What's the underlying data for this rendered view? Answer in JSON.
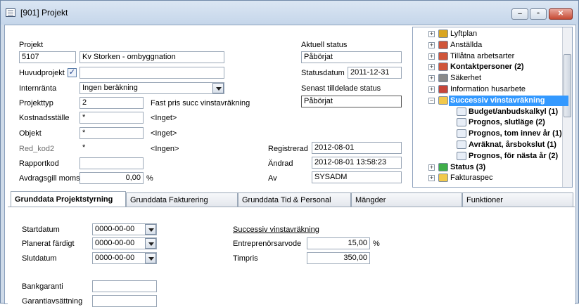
{
  "window": {
    "title": "[901]  Projekt",
    "minimize": "–",
    "maximize": "▫",
    "close": "✕"
  },
  "form": {
    "projekt_label": "Projekt",
    "projekt_id": "5107",
    "projekt_name": "Kv Storken - ombyggnation",
    "huvudprojekt_label": "Huvudprojekt",
    "huvudprojekt_checked": "✓",
    "huvudprojekt_value": "",
    "internranta_label": "Internränta",
    "internranta_value": "Ingen beräkning",
    "projekttyp_label": "Projekttyp",
    "projekttyp_value": "2",
    "projekttyp_desc": "Fast pris succ vinstavräkning",
    "kostnadsstalle_label": "Kostnadsställe",
    "kostnadsstalle_value": "*",
    "kostnadsstalle_desc": "<Inget>",
    "objekt_label": "Objekt",
    "objekt_value": "*",
    "objekt_desc": "<Inget>",
    "red_kod2_label": "Red_kod2",
    "red_kod2_value": "*",
    "red_kod2_desc": "<Ingen>",
    "rapportkod_label": "Rapportkod",
    "rapportkod_value": "",
    "moms_label": "Avdragsgill moms",
    "moms_value": "0,00",
    "moms_unit": "%"
  },
  "status": {
    "aktuell_label": "Aktuell status",
    "aktuell_value": "Påbörjat",
    "statusdatum_label": "Statusdatum",
    "statusdatum_value": "2011-12-31",
    "senast_label": "Senast tilldelade status",
    "senast_value": "Påbörjat",
    "registrerad_label": "Registrerad",
    "registrerad_value": "2012-08-01",
    "andrad_label": "Ändrad",
    "andrad_value": "2012-08-01 13:58:23",
    "av_label": "Av",
    "av_value": "SYSADM"
  },
  "tree": [
    {
      "label": "Lyftplan",
      "icon": "crane-icon",
      "bold": false
    },
    {
      "label": "Anställda",
      "icon": "person-icon",
      "bold": false
    },
    {
      "label": "Tillåtna arbetsarter",
      "icon": "person-icon",
      "bold": false
    },
    {
      "label": "Kontaktpersoner (2)",
      "icon": "person-icon",
      "bold": true
    },
    {
      "label": "Säkerhet",
      "icon": "lock-icon",
      "bold": false
    },
    {
      "label": "Information husarbete",
      "icon": "house-icon",
      "bold": false
    },
    {
      "label": "Successiv vinstavräkning",
      "icon": "folder-open-icon",
      "bold": true
    },
    {
      "label": "Budget/anbudskalkyl (1)",
      "icon": "document-icon",
      "bold": true
    },
    {
      "label": "Prognos, slutläge (2)",
      "icon": "document-icon",
      "bold": true
    },
    {
      "label": "Prognos, tom innev år (1)",
      "icon": "document-icon",
      "bold": true
    },
    {
      "label": "Avräknat, årsbokslut (1)",
      "icon": "document-icon",
      "bold": true
    },
    {
      "label": "Prognos, för nästa år (2)",
      "icon": "document-icon",
      "bold": true
    },
    {
      "label": "Status (3)",
      "icon": "status-icon",
      "bold": true
    },
    {
      "label": "Fakturaspec",
      "icon": "folder-icon",
      "bold": false
    }
  ],
  "tabs": [
    "Grunddata Projektstyrning",
    "Grunddata Fakturering",
    "Grunddata Tid & Personal",
    "Mängder",
    "Funktioner"
  ],
  "pane": {
    "startdatum_label": "Startdatum",
    "startdatum_value": "0000-00-00",
    "planerat_label": "Planerat färdigt",
    "planerat_value": "0000-00-00",
    "slutdatum_label": "Slutdatum",
    "slutdatum_value": "0000-00-00",
    "bankgaranti_label": "Bankgaranti",
    "bankgaranti_value": "",
    "garanti_label": "Garantiavsättning",
    "garanti_value": "",
    "succ_heading": "Successiv vinstavräkning",
    "entreprenor_label": "Entreprenörsarvode",
    "entreprenor_value": "15,00",
    "entreprenor_unit": "%",
    "timpris_label": "Timpris",
    "timpris_value": "350,00"
  },
  "colors": {
    "selection": "#3399ff",
    "window_frame": "#cfdbe9"
  }
}
